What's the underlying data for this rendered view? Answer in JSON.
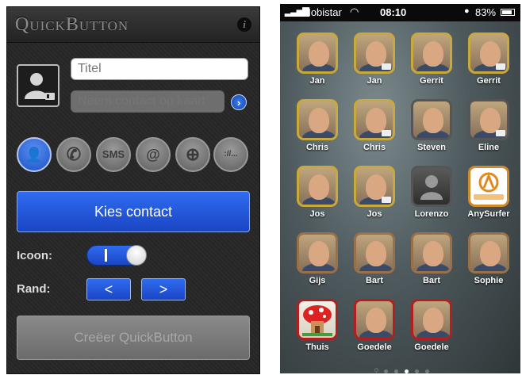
{
  "left_screen": {
    "title": "QuickButton",
    "info_icon": "i",
    "title_placeholder": "Titel",
    "contact_placeholder": "Neem contact op kaart",
    "types": [
      {
        "name": "contact-card",
        "glyph": "👤",
        "active": true
      },
      {
        "name": "phone",
        "glyph": "✆",
        "active": false
      },
      {
        "name": "sms",
        "glyph": "SMS",
        "active": false
      },
      {
        "name": "email",
        "glyph": "@",
        "active": false
      },
      {
        "name": "web",
        "glyph": "⊕",
        "active": false
      },
      {
        "name": "url",
        "glyph": "://...",
        "active": false
      }
    ],
    "kies_button": "Kies contact",
    "icoon_label": "Icoon:",
    "icoon_toggle_on": true,
    "rand_label": "Rand:",
    "rand_prev": "<",
    "rand_next": ">",
    "create_button": "Creëer QuickButton"
  },
  "right_screen": {
    "status": {
      "carrier": "Mobistar",
      "time": "08:10",
      "battery": "83%",
      "battery_level": 0.83
    },
    "apps": [
      {
        "name": "Jan",
        "border": "#c9a93a",
        "photo": "person"
      },
      {
        "name": "Jan",
        "border": "#c9a93a",
        "photo": "person"
      },
      {
        "name": "Gerrit",
        "border": "#c9a93a",
        "photo": "person"
      },
      {
        "name": "Gerrit",
        "border": "#c9a93a",
        "photo": "person"
      },
      {
        "name": "Chris",
        "border": "#c9a93a",
        "photo": "person"
      },
      {
        "name": "Chris",
        "border": "#c9a93a",
        "photo": "person"
      },
      {
        "name": "Steven",
        "border": "#555555",
        "photo": "person"
      },
      {
        "name": "Eline",
        "border": "#555555",
        "photo": "person"
      },
      {
        "name": "Jos",
        "border": "#c9a93a",
        "photo": "person"
      },
      {
        "name": "Jos",
        "border": "#c9a93a",
        "photo": "person"
      },
      {
        "name": "Lorenzo",
        "border": "#555555",
        "photo": "placeholder"
      },
      {
        "name": "AnySurfer",
        "border": "#d08a2a",
        "photo": "logo"
      },
      {
        "name": "Gijs",
        "border": "#9a7048",
        "photo": "person"
      },
      {
        "name": "Bart",
        "border": "#9a7048",
        "photo": "person"
      },
      {
        "name": "Bart",
        "border": "#9a7048",
        "photo": "person"
      },
      {
        "name": "Sophie",
        "border": "#9a7048",
        "photo": "person"
      },
      {
        "name": "Thuis",
        "border": "#b02020",
        "photo": "house"
      },
      {
        "name": "Goedele",
        "border": "#b02020",
        "photo": "person"
      },
      {
        "name": "Goedele",
        "border": "#b02020",
        "photo": "person"
      }
    ],
    "page_count": 5,
    "active_page": 3
  }
}
